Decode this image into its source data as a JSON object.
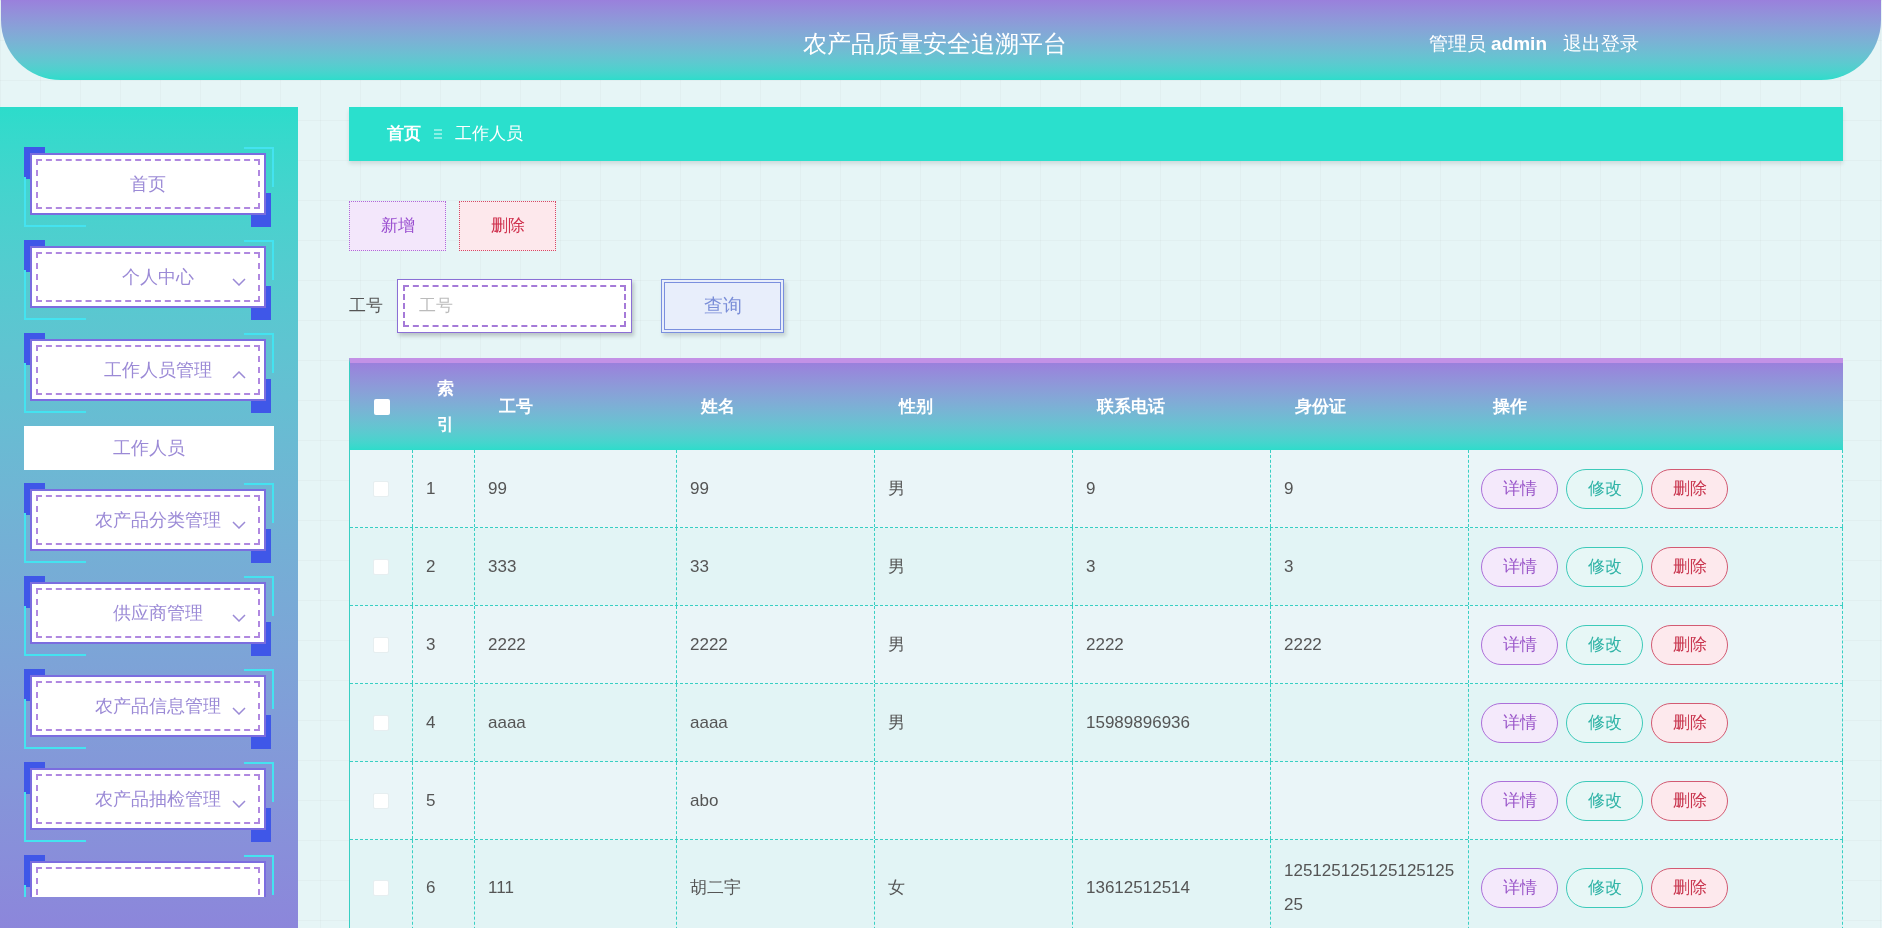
{
  "header": {
    "title": "农产品质量安全追溯平台",
    "user": "管理员 **admin**",
    "logout": "退出登录"
  },
  "sidebar": {
    "items": [
      {
        "kind": "link",
        "label": "首页"
      },
      {
        "kind": "submenu",
        "label": "个人中心",
        "expanded": false
      },
      {
        "kind": "submenu",
        "label": "工作人员管理",
        "expanded": true,
        "children": [
          {
            "label": "工作人员",
            "selected": true
          }
        ]
      },
      {
        "kind": "submenu",
        "label": "农产品分类管理",
        "expanded": false
      },
      {
        "kind": "submenu",
        "label": "供应商管理",
        "expanded": false
      },
      {
        "kind": "submenu",
        "label": "农产品信息管理",
        "expanded": false
      },
      {
        "kind": "submenu",
        "label": "农产品抽检管理",
        "expanded": false
      },
      {
        "kind": "cut"
      }
    ]
  },
  "breadcrumb": [
    "首页",
    "工作人员"
  ],
  "actions": [
    {
      "kind": "add",
      "label": "新增"
    },
    {
      "kind": "delete",
      "label": "删除"
    }
  ],
  "search": {
    "label": "工号",
    "placeholder": "工号",
    "button": "查询"
  },
  "table": {
    "select_all": {
      "checked": false
    },
    "columns": [
      "索引",
      "工号",
      "姓名",
      "性别",
      "联系电话",
      "身份证",
      "操作"
    ],
    "rows": [
      {
        "checked": false,
        "cells": [
          "1",
          "99",
          "99",
          "男",
          "9",
          "9"
        ],
        "actions": [
          {
            "kind": "detail",
            "label": "详情"
          },
          {
            "kind": "edit",
            "label": "修改"
          },
          {
            "kind": "delete",
            "label": "删除"
          }
        ]
      },
      {
        "checked": false,
        "cells": [
          "2",
          "333",
          "33",
          "男",
          "3",
          "3"
        ],
        "actions": [
          {
            "kind": "detail",
            "label": "详情"
          },
          {
            "kind": "edit",
            "label": "修改"
          },
          {
            "kind": "delete",
            "label": "删除"
          }
        ]
      },
      {
        "checked": false,
        "cells": [
          "3",
          "2222",
          "2222",
          "男",
          "2222",
          "2222"
        ],
        "actions": [
          {
            "kind": "detail",
            "label": "详情"
          },
          {
            "kind": "edit",
            "label": "修改"
          },
          {
            "kind": "delete",
            "label": "删除"
          }
        ]
      },
      {
        "checked": false,
        "cells": [
          "4",
          "aaaa",
          "aaaa",
          "男",
          "15989896936",
          ""
        ],
        "actions": [
          {
            "kind": "detail",
            "label": "详情"
          },
          {
            "kind": "edit",
            "label": "修改"
          },
          {
            "kind": "delete",
            "label": "删除"
          }
        ]
      },
      {
        "checked": false,
        "cells": [
          "5",
          "",
          "abo",
          "",
          "",
          ""
        ],
        "actions": [
          {
            "kind": "detail",
            "label": "详情"
          },
          {
            "kind": "edit",
            "label": "修改"
          },
          {
            "kind": "delete",
            "label": "删除"
          }
        ]
      },
      {
        "checked": false,
        "cells": [
          "6",
          "111",
          "胡二宇",
          "女",
          "13612512514",
          "12512512512512512525"
        ],
        "actions": [
          {
            "kind": "detail",
            "label": "详情"
          },
          {
            "kind": "edit",
            "label": "修改"
          },
          {
            "kind": "delete",
            "label": "删除"
          }
        ]
      }
    ]
  }
}
